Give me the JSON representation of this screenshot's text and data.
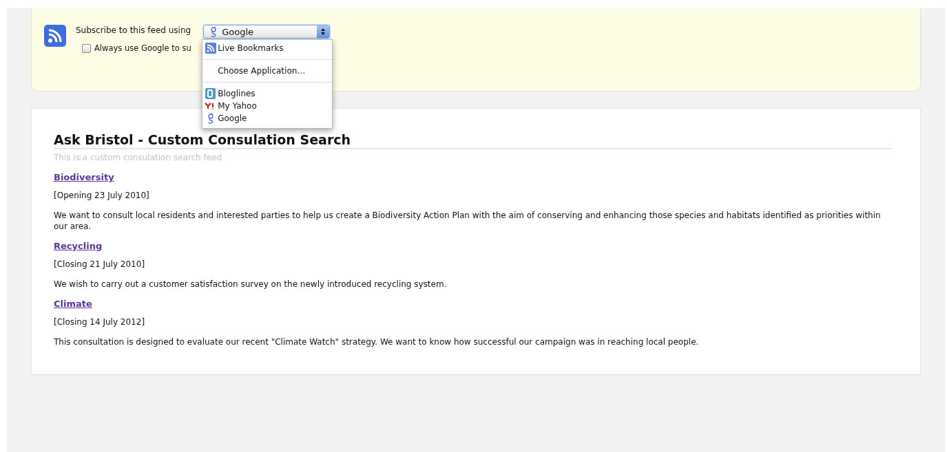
{
  "subscribe": {
    "label": "Subscribe to this feed using",
    "select": {
      "value": "Google"
    },
    "always_use": {
      "label": "Always use Google to su",
      "checked": false
    },
    "menu": [
      {
        "kind": "feed",
        "label": "Live Bookmarks"
      },
      {
        "kind": "separator"
      },
      {
        "kind": "plain",
        "label": "Choose Application…"
      },
      {
        "kind": "separator"
      },
      {
        "kind": "bloglines",
        "label": "Bloglines"
      },
      {
        "kind": "yahoo",
        "label": "My Yahoo"
      },
      {
        "kind": "google",
        "label": "Google"
      }
    ]
  },
  "feed": {
    "title": "Ask Bristol - Custom Consulation Search",
    "subtitle": "This is a custom consulation search feed",
    "entries": [
      {
        "title": "Biodiversity",
        "date": "[Opening 23 July 2010]",
        "summary": "We want to consult local residents and interested parties to help us create a Biodiversity Action Plan with the aim of conserving and enhancing those species and habitats identified as priorities within our area."
      },
      {
        "title": "Recycling",
        "date": "[Closing 21 July 2010]",
        "summary": "We wish to carry out a customer satisfaction survey on the newly introduced recycling system."
      },
      {
        "title": "Climate",
        "date": "[Closing 14 July 2012]",
        "summary": "This consultation is designed to evaluate our recent \"Climate Watch\" strategy. We want to know how successful our campaign was in reaching local people."
      }
    ]
  }
}
